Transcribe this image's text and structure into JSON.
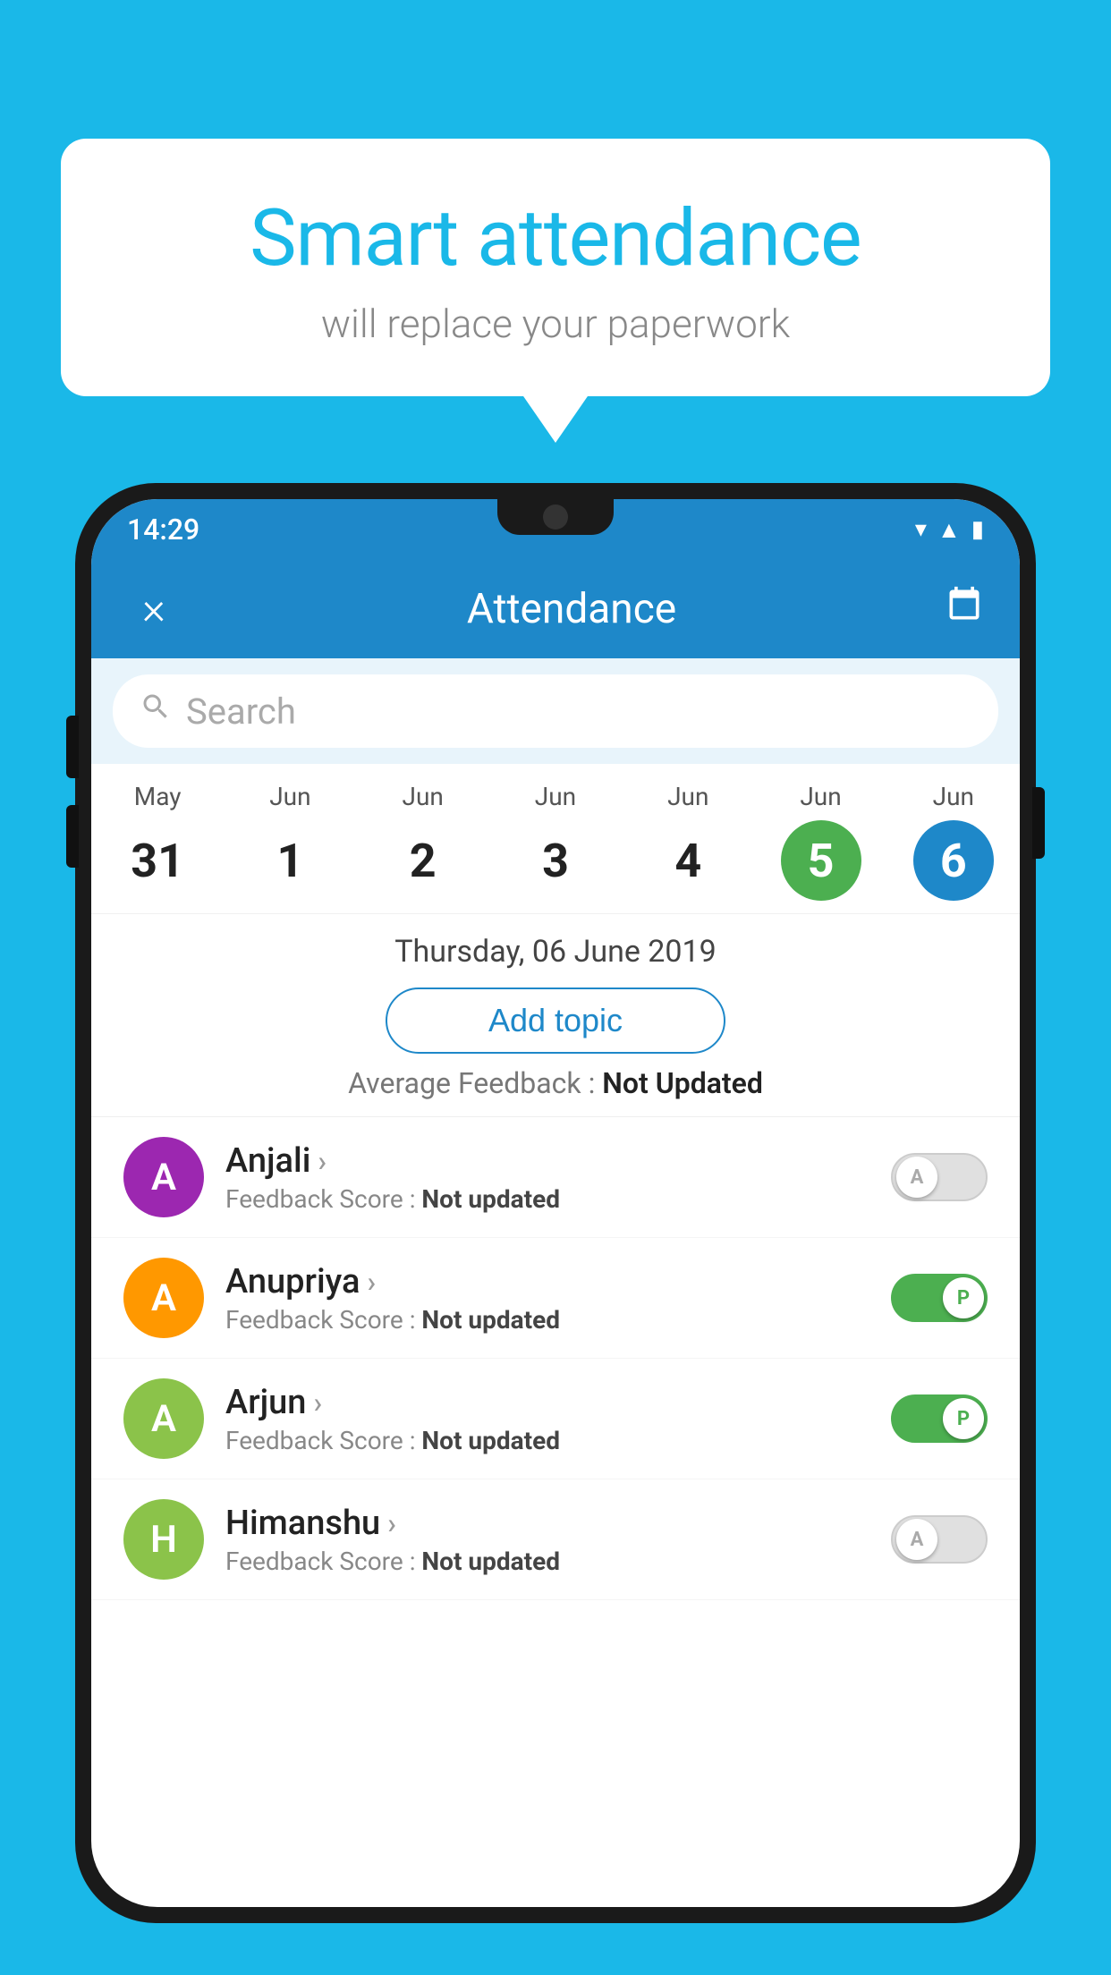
{
  "background_color": "#1ab8e8",
  "speech_bubble": {
    "title": "Smart attendance",
    "subtitle": "will replace your paperwork"
  },
  "status_bar": {
    "time": "14:29",
    "icons": [
      "wifi",
      "signal",
      "battery"
    ]
  },
  "app_bar": {
    "title": "Attendance",
    "close_label": "×",
    "calendar_label": "📅"
  },
  "search": {
    "placeholder": "Search"
  },
  "calendar": {
    "days": [
      {
        "month": "May",
        "date": "31",
        "state": "normal"
      },
      {
        "month": "Jun",
        "date": "1",
        "state": "normal"
      },
      {
        "month": "Jun",
        "date": "2",
        "state": "normal"
      },
      {
        "month": "Jun",
        "date": "3",
        "state": "normal"
      },
      {
        "month": "Jun",
        "date": "4",
        "state": "normal"
      },
      {
        "month": "Jun",
        "date": "5",
        "state": "today"
      },
      {
        "month": "Jun",
        "date": "6",
        "state": "selected"
      }
    ]
  },
  "selected_date": "Thursday, 06 June 2019",
  "add_topic_label": "Add topic",
  "avg_feedback_label": "Average Feedback :",
  "avg_feedback_value": "Not Updated",
  "students": [
    {
      "name": "Anjali",
      "initial": "A",
      "avatar_color": "#9c27b0",
      "feedback_label": "Feedback Score :",
      "feedback_value": "Not updated",
      "attendance": "off",
      "toggle_letter": "A"
    },
    {
      "name": "Anupriya",
      "initial": "A",
      "avatar_color": "#ff9800",
      "feedback_label": "Feedback Score :",
      "feedback_value": "Not updated",
      "attendance": "on",
      "toggle_letter": "P"
    },
    {
      "name": "Arjun",
      "initial": "A",
      "avatar_color": "#8bc34a",
      "feedback_label": "Feedback Score :",
      "feedback_value": "Not updated",
      "attendance": "on",
      "toggle_letter": "P"
    },
    {
      "name": "Himanshu",
      "initial": "H",
      "avatar_color": "#8bc34a",
      "feedback_label": "Feedback Score :",
      "feedback_value": "Not updated",
      "attendance": "off",
      "toggle_letter": "A"
    }
  ]
}
